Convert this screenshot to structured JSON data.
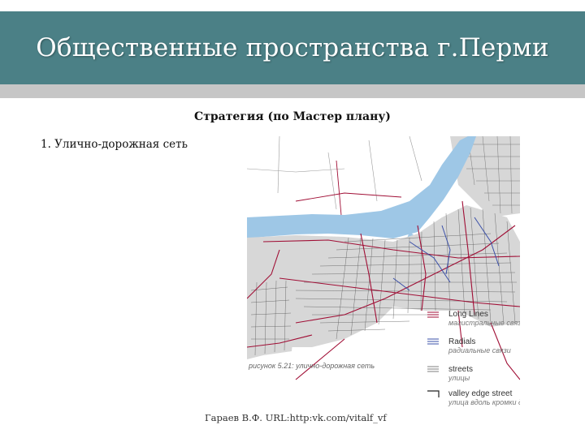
{
  "slide": {
    "title": "Общественные пространства г.Перми",
    "subtitle": "Стратегия (по Мастер плану)",
    "list_item": "1. Улично-дорожная сеть",
    "footer": "Гараев В.Ф. URL:http:vk.com/vitalf_vf"
  },
  "map": {
    "caption": "рисунок 5.21: улично-дорожная сеть",
    "colors": {
      "water": "#9ec7e6",
      "land": "#d7d7d7",
      "roads": "#a00e35",
      "radials": "#3a4fa8",
      "streets": "#555555"
    },
    "legend": [
      {
        "label": "Long Lines",
        "sub": "магистральные связи",
        "icon": "long-lines-swatch"
      },
      {
        "label": "Radials",
        "sub": "радиальные связи",
        "icon": "radials-swatch"
      },
      {
        "label": "streets",
        "sub": "улицы",
        "icon": "streets-swatch"
      },
      {
        "label": "valley edge street",
        "sub": "улица вдоль кромки долины",
        "icon": "valley-edge-swatch"
      }
    ]
  }
}
